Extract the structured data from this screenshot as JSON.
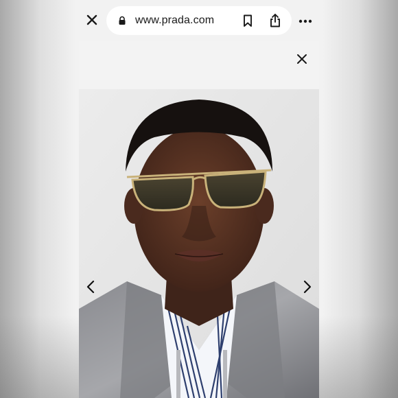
{
  "browser": {
    "url": "www.prada.com",
    "close_icon": "close-icon",
    "lock_icon": "lock-icon",
    "bookmark_icon": "bookmark-icon",
    "share_icon": "share-icon",
    "more_icon": "more-icon"
  },
  "gallery": {
    "close_icon": "close-icon",
    "prev_icon": "chevron-left-icon",
    "next_icon": "chevron-right-icon",
    "image": "model-wearing-aviator-sunglasses"
  },
  "colors": {
    "bar_background": "#f2f2f2",
    "url_pill": "#ffffff",
    "icon": "#1a1a1a",
    "gallery_background": "#f3f3f3"
  }
}
